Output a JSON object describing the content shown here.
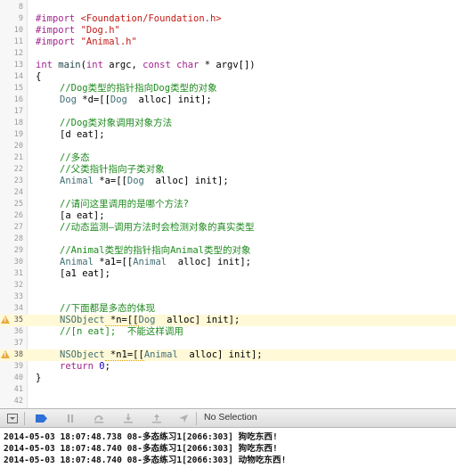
{
  "editor": {
    "gutter": {
      "line_numbers": [
        "8",
        "9",
        "10",
        "11",
        "12",
        "13",
        "14",
        "15",
        "16",
        "17",
        "18",
        "19",
        "20",
        "21",
        "22",
        "23",
        "24",
        "25",
        "26",
        "27",
        "28",
        "29",
        "30",
        "31",
        "32",
        "33",
        "34",
        "35",
        "36",
        "37",
        "38",
        "39",
        "40",
        "41",
        "42"
      ]
    },
    "code": {
      "l9": {
        "kw": "#import",
        "str": "<Foundation/Foundation.h>"
      },
      "l10": {
        "kw": "#import",
        "str": "\"Dog.h\""
      },
      "l11": {
        "kw": "#import",
        "str": "\"Animal.h\""
      },
      "l13": {
        "kw1": "int",
        "fn": "main",
        "p1": "(",
        "kw2": "int",
        "p2": " argc, ",
        "kw3": "const",
        "sp": " ",
        "kw4": "char",
        "p3": " * argv[])"
      },
      "l14": "{",
      "l15": "//Dog类型的指针指向Dog类型的对象",
      "l16": {
        "typ": "Dog",
        "rest": " *d=[[",
        "typ2": "Dog",
        "rest2": "  alloc] init];"
      },
      "l18": "//Dog类对象调用对象方法",
      "l19": "[d eat];",
      "l21": "//多态",
      "l22": "//父类指针指向子类对象",
      "l23": {
        "typ": "Animal",
        "rest": " *a=[[",
        "typ2": "Dog",
        "rest2": "  alloc] init];"
      },
      "l25": "//请问这里调用的是哪个方法?",
      "l26": "[a eat];",
      "l27": "//动态监测—调用方法时会检测对象的真实类型",
      "l29": "//Animal类型的指针指向Animal类型的对象",
      "l30": {
        "typ": "Animal",
        "rest": " *a1=[[",
        "typ2": "Animal",
        "rest2": "  alloc] init];"
      },
      "l31": "[a1 eat];",
      "l34": "//下面都是多态的体现",
      "l35": {
        "typ": "NSObject",
        "rest": " *n=[[",
        "typ2": "Dog",
        "rest2": "  alloc] init];"
      },
      "l36": {
        "c1": "//[n eat];",
        "c2": "  不能这样调用"
      },
      "l38": {
        "typ": "NSObject",
        "rest": " *n1=[[",
        "typ2": "Animal",
        "rest2": "  alloc] init];"
      },
      "l39": {
        "kw": "return",
        "num": "0",
        "semi": ";"
      },
      "l40": "}"
    }
  },
  "debug_bar": {
    "selection_label": "No Selection"
  },
  "console": {
    "lines": [
      "2014-05-03 18:07:48.738 08-多态练习1[2066:303] 狗吃东西!",
      "2014-05-03 18:07:48.740 08-多态练习1[2066:303] 狗吃东西!",
      "2014-05-03 18:07:48.740 08-多态练习1[2066:303] 动物吃东西!"
    ]
  },
  "colors": {
    "comment": "#1f8a1f",
    "keyword": "#a3238f",
    "string": "#c41a16",
    "type": "#3f6e74",
    "warning": "#e8a93a"
  }
}
